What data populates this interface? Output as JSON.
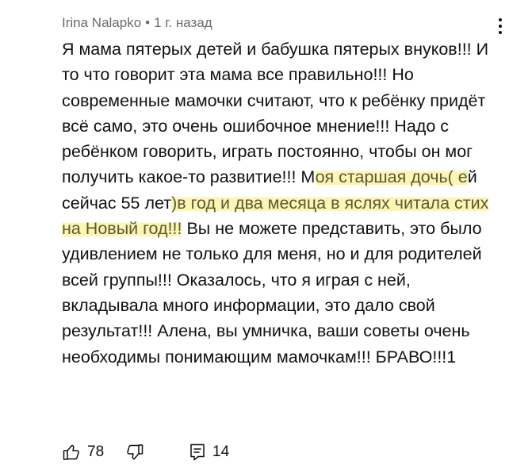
{
  "comment": {
    "author": "Irina Nalapko",
    "separator": "•",
    "time": "1 г. назад",
    "text_before": "Я мама пятерых детей и бабушка пятерых внуков!!! И то что говорит эта мама все правильно!!! Но современные мамочки считают, что к ребёнку придёт всё само, это очень ошибочное мнение!!! Надо с ребёнком говорить, играть постоянно, чтобы он мог получить какое-то развитие!!! М",
    "text_highlighted_1": "оя старшая дочь( е",
    "text_middle": "й сейчас 55 лет",
    "text_highlighted_2": ")в год и два месяца в яслях читала стих на Новый год!!!",
    "text_after": " Вы не можете представить, это было удивлением не только для меня, но и для родителей всей группы!!! Оказалось, что я играя с ней, вкладывала много информации, это дало свой результат!!! Алена, вы умничка, ваши советы очень необходимы понимающим мамочкам!!! БРАВО!!!1",
    "likes": "78",
    "replies": "14"
  },
  "icons": {
    "menu": "vertical-dots-icon",
    "like": "thumbs-up-icon",
    "dislike": "thumbs-down-icon",
    "reply": "reply-comment-icon"
  },
  "colors": {
    "highlight": "#fbf6b4",
    "meta_text": "#6b6b6b"
  }
}
